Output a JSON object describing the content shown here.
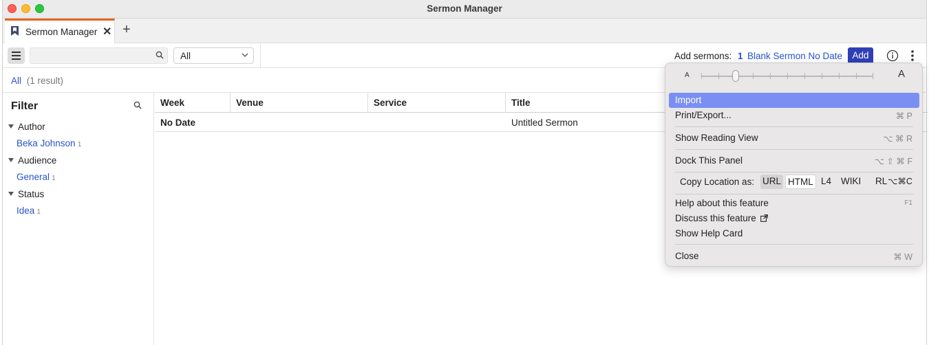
{
  "window": {
    "title": "Sermon Manager"
  },
  "tabs": [
    {
      "label": "Sermon Manager",
      "active": true
    }
  ],
  "toolbar": {
    "search_value": "",
    "filter_select": "All",
    "add_label": "Add sermons:",
    "add_count": "1",
    "add_description": "Blank Sermon No Date",
    "add_button": "Add"
  },
  "breadcrumb": {
    "all": "All",
    "result": "(1 result)"
  },
  "filter": {
    "title": "Filter",
    "groups": [
      {
        "label": "Author",
        "items": [
          {
            "label": "Beka Johnson",
            "count": "1"
          }
        ]
      },
      {
        "label": "Audience",
        "items": [
          {
            "label": "General",
            "count": "1"
          }
        ]
      },
      {
        "label": "Status",
        "items": [
          {
            "label": "Idea",
            "count": "1"
          }
        ]
      }
    ]
  },
  "table": {
    "columns": [
      "Week",
      "Venue",
      "Service",
      "Title"
    ],
    "rows": [
      {
        "week": "No Date",
        "venue": "",
        "service": "",
        "title": "Untitled Sermon"
      }
    ]
  },
  "menu": {
    "zoom_small": "A",
    "zoom_large": "A",
    "items": {
      "import": "Import",
      "print_export": "Print/Export...",
      "print_shortcut": "⌘ P",
      "reading_view": "Show Reading View",
      "reading_shortcut": "⌥ ⌘ R",
      "dock": "Dock This Panel",
      "dock_shortcut": "⌥ ⇧ ⌘ F",
      "copy_label": "Copy Location as:",
      "copy_url": "URL",
      "copy_html": "HTML",
      "copy_l4": "L4",
      "copy_wiki": "WIKI",
      "copy_rl": "RL",
      "copy_shortcut": "⌥⌘C",
      "help": "Help about this feature",
      "help_shortcut": "F1",
      "discuss": "Discuss this feature",
      "help_card": "Show Help Card",
      "close": "Close",
      "close_shortcut": "⌘ W"
    }
  },
  "colors": {
    "accent": "#2f3fb7",
    "link": "#2a55c9",
    "tab_accent": "#e8621a",
    "menu_highlight": "#7b8ff2"
  }
}
